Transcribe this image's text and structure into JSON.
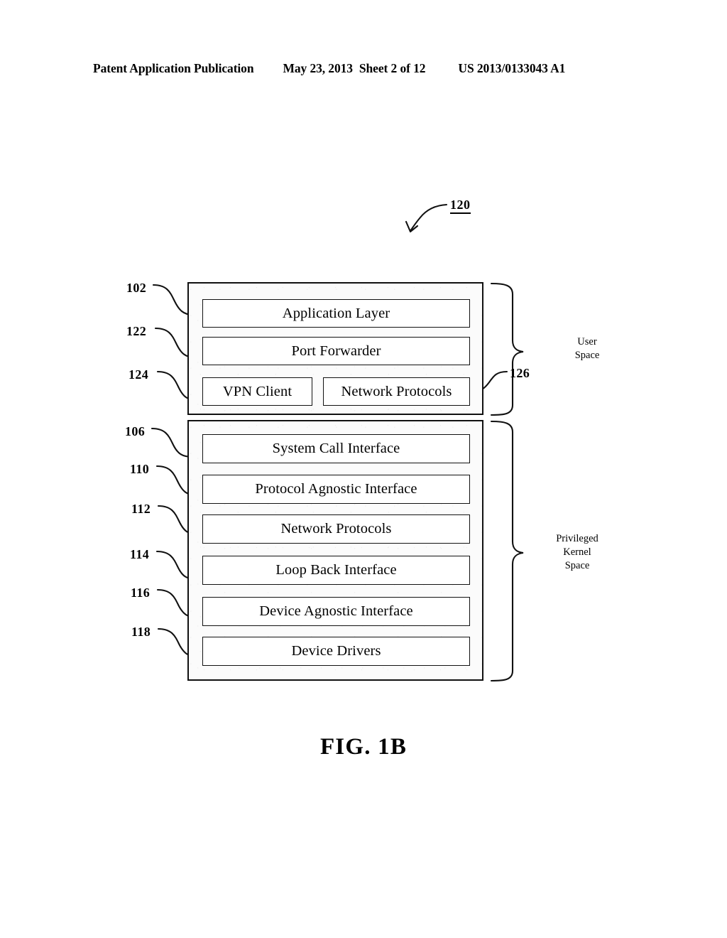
{
  "header": {
    "publication": "Patent Application Publication",
    "date": "May 23, 2013",
    "sheet": "Sheet 2 of 12",
    "patent_number": "US 2013/0133043 A1"
  },
  "figure": {
    "caption": "FIG. 1B",
    "diagram_ref": "120",
    "groups": [
      {
        "ref": "126",
        "brace_label": "User\nSpace",
        "layers": [
          {
            "ref": "102",
            "label": "Application Layer"
          },
          {
            "ref": "122",
            "label": "Port Forwarder"
          },
          {
            "ref": "124",
            "label": "VPN Client"
          },
          {
            "ref": "126",
            "label": "Network Protocols"
          }
        ]
      },
      {
        "brace_label": "Privileged\nKernel\nSpace",
        "layers": [
          {
            "ref": "106",
            "label": "System Call Interface"
          },
          {
            "ref": "110",
            "label": "Protocol Agnostic Interface"
          },
          {
            "ref": "112",
            "label": "Network Protocols"
          },
          {
            "ref": "114",
            "label": "Loop Back Interface"
          },
          {
            "ref": "116",
            "label": "Device Agnostic Interface"
          },
          {
            "ref": "118",
            "label": "Device Drivers"
          }
        ]
      }
    ],
    "reference_numerals": {
      "n102": "102",
      "n122": "122",
      "n124": "124",
      "n126": "126",
      "n106": "106",
      "n110": "110",
      "n112": "112",
      "n114": "114",
      "n116": "116",
      "n118": "118",
      "n120": "120"
    },
    "labels": {
      "application_layer": "Application Layer",
      "port_forwarder": "Port Forwarder",
      "vpn_client": "VPN Client",
      "network_protocols_user": "Network Protocols",
      "system_call_interface": "System Call Interface",
      "protocol_agnostic_interface": "Protocol Agnostic Interface",
      "network_protocols_kernel": "Network Protocols",
      "loop_back_interface": "Loop Back Interface",
      "device_agnostic_interface": "Device Agnostic Interface",
      "device_drivers": "Device Drivers",
      "user_space": "User\nSpace",
      "privileged_kernel_space": "Privileged\nKernel\nSpace"
    },
    "colors": {
      "ink": "#111111",
      "paper": "#ffffff",
      "box_fill": "#fbfbfb"
    }
  }
}
